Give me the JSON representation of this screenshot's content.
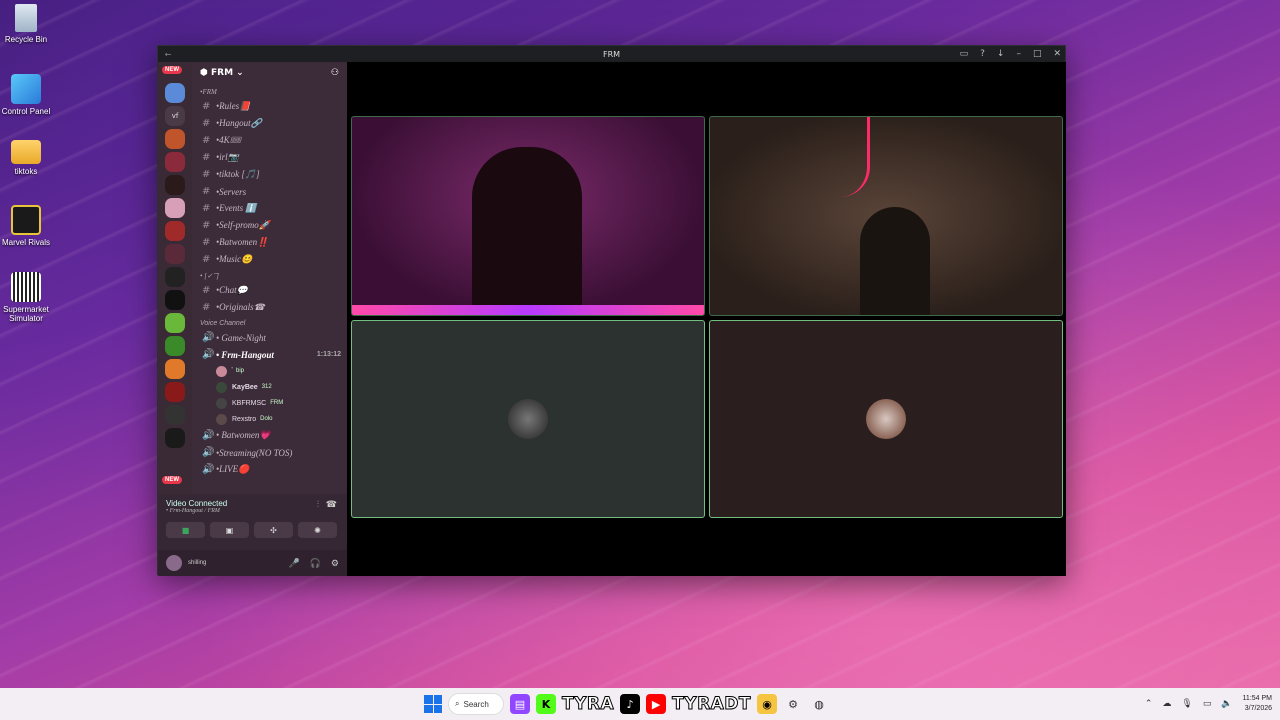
{
  "desktop": {
    "icons": [
      {
        "label": "Recycle Bin",
        "icon": "recycle-bin-icon"
      },
      {
        "label": "Control Panel",
        "icon": "control-panel-icon"
      },
      {
        "label": "tiktoks",
        "icon": "folder-icon"
      },
      {
        "label": "Marvel Rivals",
        "icon": "marvel-rivals-icon"
      },
      {
        "label": "Supermarket Simulator",
        "icon": "supermarket-simulator-icon"
      }
    ]
  },
  "window": {
    "title": "FRM",
    "server_name": "FRM",
    "rail_badges": [
      "NEW",
      "NEW"
    ],
    "rail_text_server": "vf"
  },
  "sidebar": {
    "category_frm": "•FRM",
    "text_channels": [
      "•Rules📕",
      "•Hangout🔗",
      "•4K🎟",
      "•irl📷",
      "•tiktok [🎵]",
      "•Servers",
      "•Events ℹ️",
      "•Self-promo🚀",
      "•Batwomen‼️",
      "•Music😊"
    ],
    "category_2": "• [✓ ̄ ̄]",
    "text_channels_2": [
      "•Chat💬",
      "•Originals☎"
    ],
    "voice_category": "Voice Channel",
    "voice_channels": [
      {
        "name": "• Game-Night",
        "active": false
      },
      {
        "name": "• Frm-Hangout",
        "active": true,
        "timer": "1:13:12"
      }
    ],
    "voice_members": [
      {
        "name": "ⷮ",
        "tag": "bip"
      },
      {
        "name": "KayBee",
        "tag": "312"
      },
      {
        "name": "KBFRMSC",
        "tag": "FRM"
      },
      {
        "name": "Rexstro",
        "tag": "Dolo"
      }
    ],
    "voice_channels_2": [
      "• Batwomen💗",
      "•Streaming(NO TOS)",
      "•LIVE🔴"
    ]
  },
  "voice_panel": {
    "status": "Video Connected",
    "location": "• Frm-Hangout / FRM"
  },
  "user_panel": {
    "status": "shilling"
  },
  "taskbar": {
    "search_label": "Search",
    "brand_1": "TYRA",
    "brand_2": "TYRADT",
    "time": "11:54 PM",
    "date": "3/7/2026"
  },
  "colors": {
    "discord_green": "#3ba55c",
    "tile_border": "#6fbf7f",
    "new_badge": "#e8364a"
  }
}
